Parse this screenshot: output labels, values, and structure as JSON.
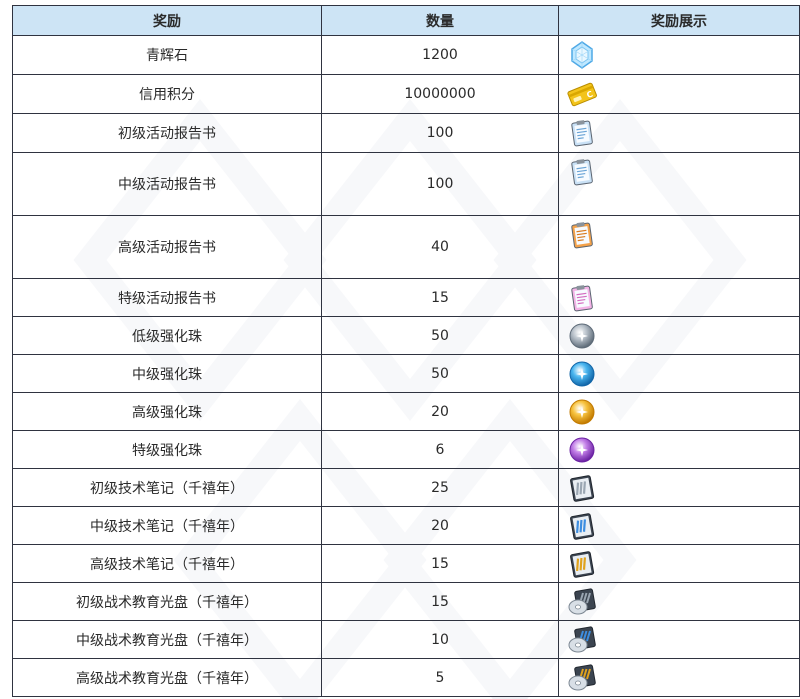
{
  "table": {
    "headers": {
      "reward": "奖励",
      "quantity": "数量",
      "display": "奖励展示"
    },
    "rows": [
      {
        "name": "青辉石",
        "qty": "1200",
        "icon": "pyroxene-crystal-icon"
      },
      {
        "name": "信用积分",
        "qty": "10000000",
        "icon": "credit-card-icon"
      },
      {
        "name": "初级活动报告书",
        "qty": "100",
        "icon": "report-blue-icon"
      },
      {
        "name": "中级活动报告书",
        "qty": "100",
        "icon": "report-blue-icon"
      },
      {
        "name": "高级活动报告书",
        "qty": "40",
        "icon": "report-orange-icon"
      },
      {
        "name": "特级活动报告书",
        "qty": "15",
        "icon": "report-pink-icon"
      },
      {
        "name": "低级强化珠",
        "qty": "50",
        "icon": "orb-gray-icon"
      },
      {
        "name": "中级强化珠",
        "qty": "50",
        "icon": "orb-blue-icon"
      },
      {
        "name": "高级强化珠",
        "qty": "20",
        "icon": "orb-gold-icon"
      },
      {
        "name": "特级强化珠",
        "qty": "6",
        "icon": "orb-purple-icon"
      },
      {
        "name": "初级技术笔记（千禧年）",
        "qty": "25",
        "icon": "tech-note-gray-icon"
      },
      {
        "name": "中级技术笔记（千禧年）",
        "qty": "20",
        "icon": "tech-note-blue-icon"
      },
      {
        "name": "高级技术笔记（千禧年）",
        "qty": "15",
        "icon": "tech-note-gold-icon"
      },
      {
        "name": "初级战术教育光盘（千禧年）",
        "qty": "15",
        "icon": "disc-gray-icon"
      },
      {
        "name": "中级战术教育光盘（千禧年）",
        "qty": "10",
        "icon": "disc-blue-icon"
      },
      {
        "name": "高级战术教育光盘（千禧年）",
        "qty": "5",
        "icon": "disc-gold-icon"
      }
    ]
  },
  "colors": {
    "header_bg": "#cde4f5",
    "border": "#2f3340",
    "text": "#2a2a2a"
  }
}
